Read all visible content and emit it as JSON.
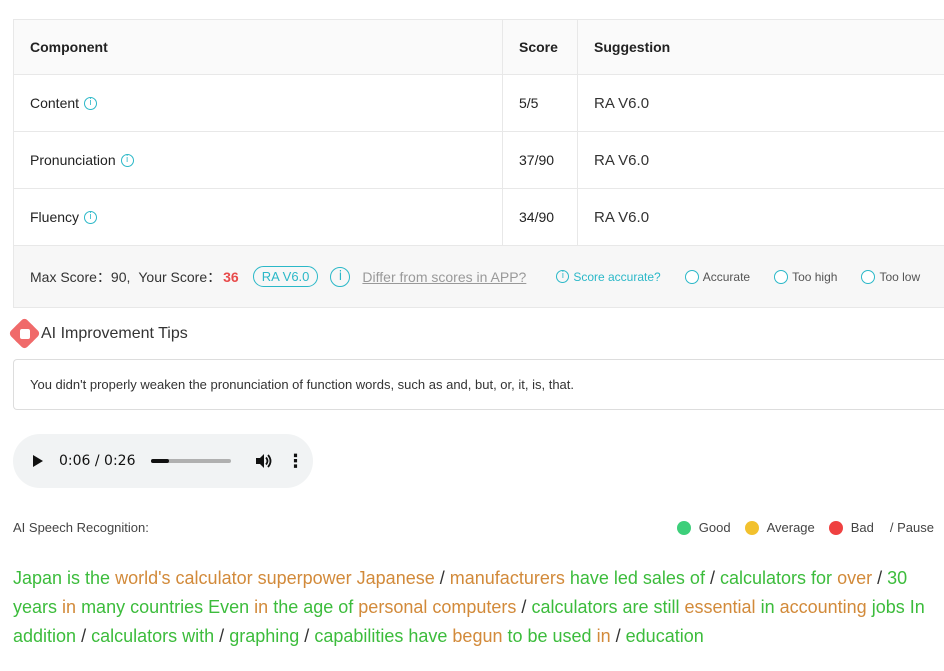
{
  "table": {
    "headers": [
      "Component",
      "Score",
      "Suggestion"
    ],
    "rows": [
      {
        "component": "Content",
        "score": "5/5",
        "suggestion": "RA V6.0"
      },
      {
        "component": "Pronunciation",
        "score": "37/90",
        "suggestion": "RA V6.0"
      },
      {
        "component": "Fluency",
        "score": "34/90",
        "suggestion": "RA V6.0"
      }
    ]
  },
  "summary": {
    "max_label": "Max Score：90,",
    "your_label": "Your Score：",
    "your_score": "36",
    "version": "RA V6.0",
    "differ_link": "Differ from scores in APP?",
    "accurate_question": "Score accurate?",
    "options": [
      "Accurate",
      "Too high",
      "Too low"
    ]
  },
  "tips": {
    "title": "AI Improvement Tips",
    "text": "You didn't properly weaken the pronunciation of function words, such as and, but, or, it, is, that."
  },
  "player": {
    "time": "0:06 / 0:26",
    "progress": 0.23
  },
  "recognition": {
    "label": "AI Speech Recognition:",
    "legend": [
      {
        "label": "Good",
        "color": "#3dcf7a"
      },
      {
        "label": "Average",
        "color": "#f2c12e"
      },
      {
        "label": "Bad",
        "color": "#ef4141"
      }
    ],
    "pause_label": "/ Pause"
  },
  "transcript": [
    {
      "t": "Japan is the",
      "c": "good"
    },
    {
      "t": "world's calculator",
      "c": "average"
    },
    {
      "t": "superpower Japanese",
      "c": "average"
    },
    {
      "t": "/",
      "c": "pause"
    },
    {
      "t": "manufacturers",
      "c": "average"
    },
    {
      "t": "have led sales of",
      "c": "good"
    },
    {
      "t": "/",
      "c": "pause"
    },
    {
      "t": "calculators for",
      "c": "good"
    },
    {
      "t": "over",
      "c": "average"
    },
    {
      "t": "/",
      "c": "pause"
    },
    {
      "t": "30 years",
      "c": "good"
    },
    {
      "t": "in",
      "c": "average"
    },
    {
      "t": "many countries Even",
      "c": "good"
    },
    {
      "t": "in",
      "c": "average"
    },
    {
      "t": "the age of",
      "c": "good"
    },
    {
      "t": "personal computers",
      "c": "average"
    },
    {
      "t": "/",
      "c": "pause"
    },
    {
      "t": "calculators are still",
      "c": "good"
    },
    {
      "t": " essential",
      "c": "average"
    },
    {
      "t": "in",
      "c": "good"
    },
    {
      "t": "accounting",
      "c": "average"
    },
    {
      "t": "jobs In addition",
      "c": "good"
    },
    {
      "t": "/",
      "c": "pause"
    },
    {
      "t": "calculators with",
      "c": "good"
    },
    {
      "t": "/",
      "c": "pause"
    },
    {
      "t": "graphing",
      "c": "good"
    },
    {
      "t": "/",
      "c": "pause"
    },
    {
      "t": "capabilities have",
      "c": "good"
    },
    {
      "t": "begun",
      "c": "average"
    },
    {
      "t": "to be used",
      "c": "good"
    },
    {
      "t": "in",
      "c": "average"
    },
    {
      "t": "/",
      "c": "pause"
    },
    {
      "t": "education",
      "c": "good"
    }
  ]
}
